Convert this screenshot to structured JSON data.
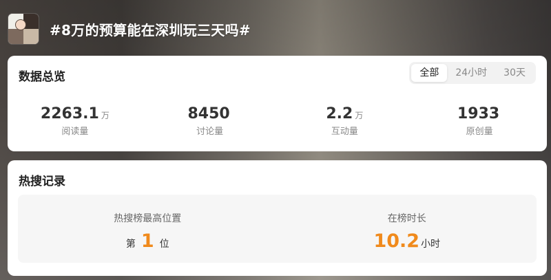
{
  "topic": {
    "title": "#8万的预算能在深圳玩三天吗#"
  },
  "overview": {
    "title": "数据总览",
    "tabs": [
      "全部",
      "24小时",
      "30天"
    ],
    "active_tab": "全部",
    "stats": [
      {
        "value": "2263.1",
        "unit": "万",
        "label": "阅读量"
      },
      {
        "value": "8450",
        "unit": "",
        "label": "讨论量"
      },
      {
        "value": "2.2",
        "unit": "万",
        "label": "互动量"
      },
      {
        "value": "1933",
        "unit": "",
        "label": "原创量"
      }
    ]
  },
  "hot_search": {
    "title": "热搜记录",
    "highest_position": {
      "label": "热搜榜最高位置",
      "prefix": "第",
      "value": "1",
      "suffix": "位"
    },
    "duration": {
      "label": "在榜时长",
      "value": "10.2",
      "suffix": "小时"
    }
  },
  "colors": {
    "accent": "#f08a1c",
    "card_bg": "#ffffff",
    "panel_bg": "#f6f6f6"
  }
}
